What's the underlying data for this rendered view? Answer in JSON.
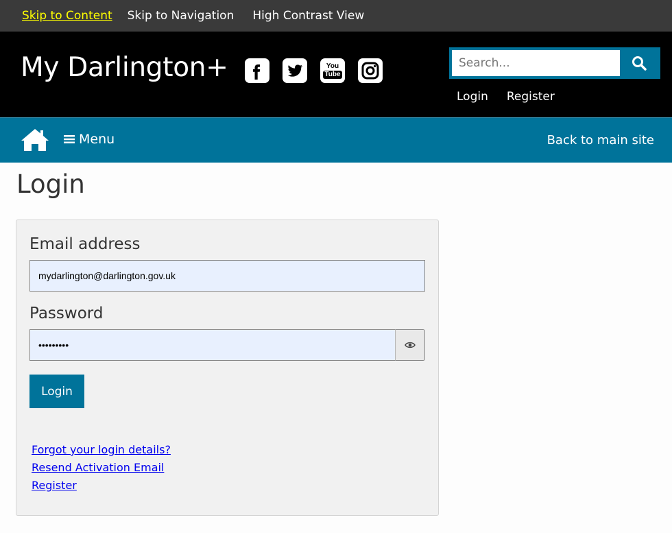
{
  "skipbar": {
    "skip_content": "Skip to Content",
    "skip_navigation": "Skip to Navigation",
    "high_contrast": "High Contrast View"
  },
  "header": {
    "site_title": "My Darlington+",
    "socials": [
      {
        "name": "facebook-icon"
      },
      {
        "name": "twitter-icon"
      },
      {
        "name": "youtube-icon",
        "text_top": "You",
        "text_bottom": "Tube"
      },
      {
        "name": "instagram-icon"
      }
    ],
    "search": {
      "placeholder": "Search...",
      "icon": "search-icon"
    },
    "login_label": "Login",
    "register_label": "Register"
  },
  "nav": {
    "home_icon": "home-icon",
    "menu_label": "Menu",
    "back_label": "Back to main site"
  },
  "main": {
    "page_title": "Login",
    "form": {
      "email_label": "Email address",
      "email_value": "mydarlington@darlington.gov.uk",
      "password_label": "Password",
      "password_value": "•••••••••",
      "toggle_icon": "eye-icon",
      "submit_label": "Login"
    },
    "links": {
      "forgot": "Forgot your login details?",
      "resend": "Resend Activation Email",
      "register": "Register"
    }
  },
  "colors": {
    "brand_blue": "#00739a",
    "header_black": "#000000",
    "skipbar_grey": "#3a3a3a",
    "skip_link_yellow": "#ffff00",
    "autofill_blue": "#e8f0fe"
  }
}
